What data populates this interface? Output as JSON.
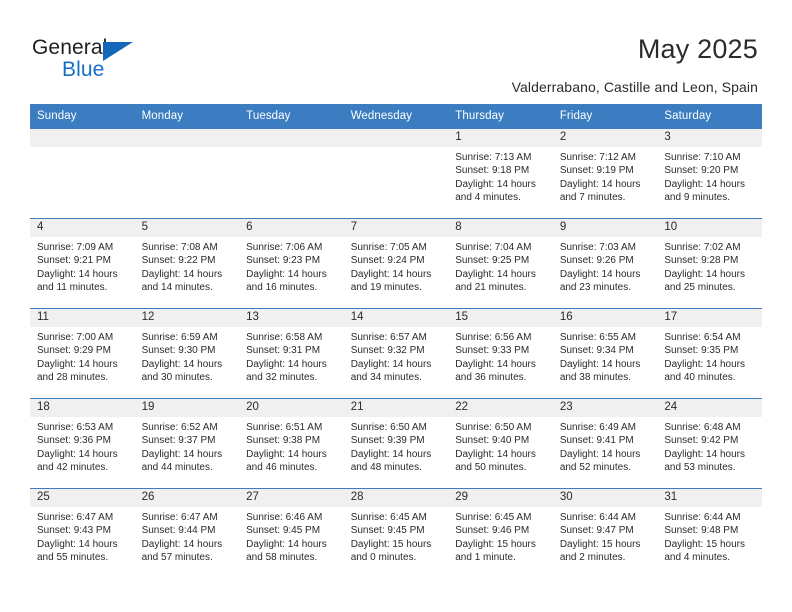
{
  "brand": {
    "name_top": "General",
    "name_bottom": "Blue",
    "triangle_color": "#1565b8",
    "text_color": "#231f20",
    "blue_text_color": "#1571c8"
  },
  "header": {
    "title": "May 2025",
    "subtitle": "Valderrabano, Castille and Leon, Spain"
  },
  "colors": {
    "header_row_bg": "#3b7dc0",
    "header_row_text": "#ffffff",
    "daynum_band_bg": "#f0f0f0",
    "cell_text": "#2b2b2b",
    "row_border": "#3b7dc0"
  },
  "weekdays": [
    "Sunday",
    "Monday",
    "Tuesday",
    "Wednesday",
    "Thursday",
    "Friday",
    "Saturday"
  ],
  "labels": {
    "sunrise_prefix": "Sunrise:",
    "sunset_prefix": "Sunset:",
    "daylight_prefix": "Daylight:"
  },
  "weeks": [
    [
      {
        "day": "",
        "sunrise": "",
        "sunset": "",
        "daylight_line1": "",
        "daylight_line2": ""
      },
      {
        "day": "",
        "sunrise": "",
        "sunset": "",
        "daylight_line1": "",
        "daylight_line2": ""
      },
      {
        "day": "",
        "sunrise": "",
        "sunset": "",
        "daylight_line1": "",
        "daylight_line2": ""
      },
      {
        "day": "",
        "sunrise": "",
        "sunset": "",
        "daylight_line1": "",
        "daylight_line2": ""
      },
      {
        "day": "1",
        "sunrise": "Sunrise: 7:13 AM",
        "sunset": "Sunset: 9:18 PM",
        "daylight_line1": "Daylight: 14 hours",
        "daylight_line2": "and 4 minutes."
      },
      {
        "day": "2",
        "sunrise": "Sunrise: 7:12 AM",
        "sunset": "Sunset: 9:19 PM",
        "daylight_line1": "Daylight: 14 hours",
        "daylight_line2": "and 7 minutes."
      },
      {
        "day": "3",
        "sunrise": "Sunrise: 7:10 AM",
        "sunset": "Sunset: 9:20 PM",
        "daylight_line1": "Daylight: 14 hours",
        "daylight_line2": "and 9 minutes."
      }
    ],
    [
      {
        "day": "4",
        "sunrise": "Sunrise: 7:09 AM",
        "sunset": "Sunset: 9:21 PM",
        "daylight_line1": "Daylight: 14 hours",
        "daylight_line2": "and 11 minutes."
      },
      {
        "day": "5",
        "sunrise": "Sunrise: 7:08 AM",
        "sunset": "Sunset: 9:22 PM",
        "daylight_line1": "Daylight: 14 hours",
        "daylight_line2": "and 14 minutes."
      },
      {
        "day": "6",
        "sunrise": "Sunrise: 7:06 AM",
        "sunset": "Sunset: 9:23 PM",
        "daylight_line1": "Daylight: 14 hours",
        "daylight_line2": "and 16 minutes."
      },
      {
        "day": "7",
        "sunrise": "Sunrise: 7:05 AM",
        "sunset": "Sunset: 9:24 PM",
        "daylight_line1": "Daylight: 14 hours",
        "daylight_line2": "and 19 minutes."
      },
      {
        "day": "8",
        "sunrise": "Sunrise: 7:04 AM",
        "sunset": "Sunset: 9:25 PM",
        "daylight_line1": "Daylight: 14 hours",
        "daylight_line2": "and 21 minutes."
      },
      {
        "day": "9",
        "sunrise": "Sunrise: 7:03 AM",
        "sunset": "Sunset: 9:26 PM",
        "daylight_line1": "Daylight: 14 hours",
        "daylight_line2": "and 23 minutes."
      },
      {
        "day": "10",
        "sunrise": "Sunrise: 7:02 AM",
        "sunset": "Sunset: 9:28 PM",
        "daylight_line1": "Daylight: 14 hours",
        "daylight_line2": "and 25 minutes."
      }
    ],
    [
      {
        "day": "11",
        "sunrise": "Sunrise: 7:00 AM",
        "sunset": "Sunset: 9:29 PM",
        "daylight_line1": "Daylight: 14 hours",
        "daylight_line2": "and 28 minutes."
      },
      {
        "day": "12",
        "sunrise": "Sunrise: 6:59 AM",
        "sunset": "Sunset: 9:30 PM",
        "daylight_line1": "Daylight: 14 hours",
        "daylight_line2": "and 30 minutes."
      },
      {
        "day": "13",
        "sunrise": "Sunrise: 6:58 AM",
        "sunset": "Sunset: 9:31 PM",
        "daylight_line1": "Daylight: 14 hours",
        "daylight_line2": "and 32 minutes."
      },
      {
        "day": "14",
        "sunrise": "Sunrise: 6:57 AM",
        "sunset": "Sunset: 9:32 PM",
        "daylight_line1": "Daylight: 14 hours",
        "daylight_line2": "and 34 minutes."
      },
      {
        "day": "15",
        "sunrise": "Sunrise: 6:56 AM",
        "sunset": "Sunset: 9:33 PM",
        "daylight_line1": "Daylight: 14 hours",
        "daylight_line2": "and 36 minutes."
      },
      {
        "day": "16",
        "sunrise": "Sunrise: 6:55 AM",
        "sunset": "Sunset: 9:34 PM",
        "daylight_line1": "Daylight: 14 hours",
        "daylight_line2": "and 38 minutes."
      },
      {
        "day": "17",
        "sunrise": "Sunrise: 6:54 AM",
        "sunset": "Sunset: 9:35 PM",
        "daylight_line1": "Daylight: 14 hours",
        "daylight_line2": "and 40 minutes."
      }
    ],
    [
      {
        "day": "18",
        "sunrise": "Sunrise: 6:53 AM",
        "sunset": "Sunset: 9:36 PM",
        "daylight_line1": "Daylight: 14 hours",
        "daylight_line2": "and 42 minutes."
      },
      {
        "day": "19",
        "sunrise": "Sunrise: 6:52 AM",
        "sunset": "Sunset: 9:37 PM",
        "daylight_line1": "Daylight: 14 hours",
        "daylight_line2": "and 44 minutes."
      },
      {
        "day": "20",
        "sunrise": "Sunrise: 6:51 AM",
        "sunset": "Sunset: 9:38 PM",
        "daylight_line1": "Daylight: 14 hours",
        "daylight_line2": "and 46 minutes."
      },
      {
        "day": "21",
        "sunrise": "Sunrise: 6:50 AM",
        "sunset": "Sunset: 9:39 PM",
        "daylight_line1": "Daylight: 14 hours",
        "daylight_line2": "and 48 minutes."
      },
      {
        "day": "22",
        "sunrise": "Sunrise: 6:50 AM",
        "sunset": "Sunset: 9:40 PM",
        "daylight_line1": "Daylight: 14 hours",
        "daylight_line2": "and 50 minutes."
      },
      {
        "day": "23",
        "sunrise": "Sunrise: 6:49 AM",
        "sunset": "Sunset: 9:41 PM",
        "daylight_line1": "Daylight: 14 hours",
        "daylight_line2": "and 52 minutes."
      },
      {
        "day": "24",
        "sunrise": "Sunrise: 6:48 AM",
        "sunset": "Sunset: 9:42 PM",
        "daylight_line1": "Daylight: 14 hours",
        "daylight_line2": "and 53 minutes."
      }
    ],
    [
      {
        "day": "25",
        "sunrise": "Sunrise: 6:47 AM",
        "sunset": "Sunset: 9:43 PM",
        "daylight_line1": "Daylight: 14 hours",
        "daylight_line2": "and 55 minutes."
      },
      {
        "day": "26",
        "sunrise": "Sunrise: 6:47 AM",
        "sunset": "Sunset: 9:44 PM",
        "daylight_line1": "Daylight: 14 hours",
        "daylight_line2": "and 57 minutes."
      },
      {
        "day": "27",
        "sunrise": "Sunrise: 6:46 AM",
        "sunset": "Sunset: 9:45 PM",
        "daylight_line1": "Daylight: 14 hours",
        "daylight_line2": "and 58 minutes."
      },
      {
        "day": "28",
        "sunrise": "Sunrise: 6:45 AM",
        "sunset": "Sunset: 9:45 PM",
        "daylight_line1": "Daylight: 15 hours",
        "daylight_line2": "and 0 minutes."
      },
      {
        "day": "29",
        "sunrise": "Sunrise: 6:45 AM",
        "sunset": "Sunset: 9:46 PM",
        "daylight_line1": "Daylight: 15 hours",
        "daylight_line2": "and 1 minute."
      },
      {
        "day": "30",
        "sunrise": "Sunrise: 6:44 AM",
        "sunset": "Sunset: 9:47 PM",
        "daylight_line1": "Daylight: 15 hours",
        "daylight_line2": "and 2 minutes."
      },
      {
        "day": "31",
        "sunrise": "Sunrise: 6:44 AM",
        "sunset": "Sunset: 9:48 PM",
        "daylight_line1": "Daylight: 15 hours",
        "daylight_line2": "and 4 minutes."
      }
    ]
  ]
}
